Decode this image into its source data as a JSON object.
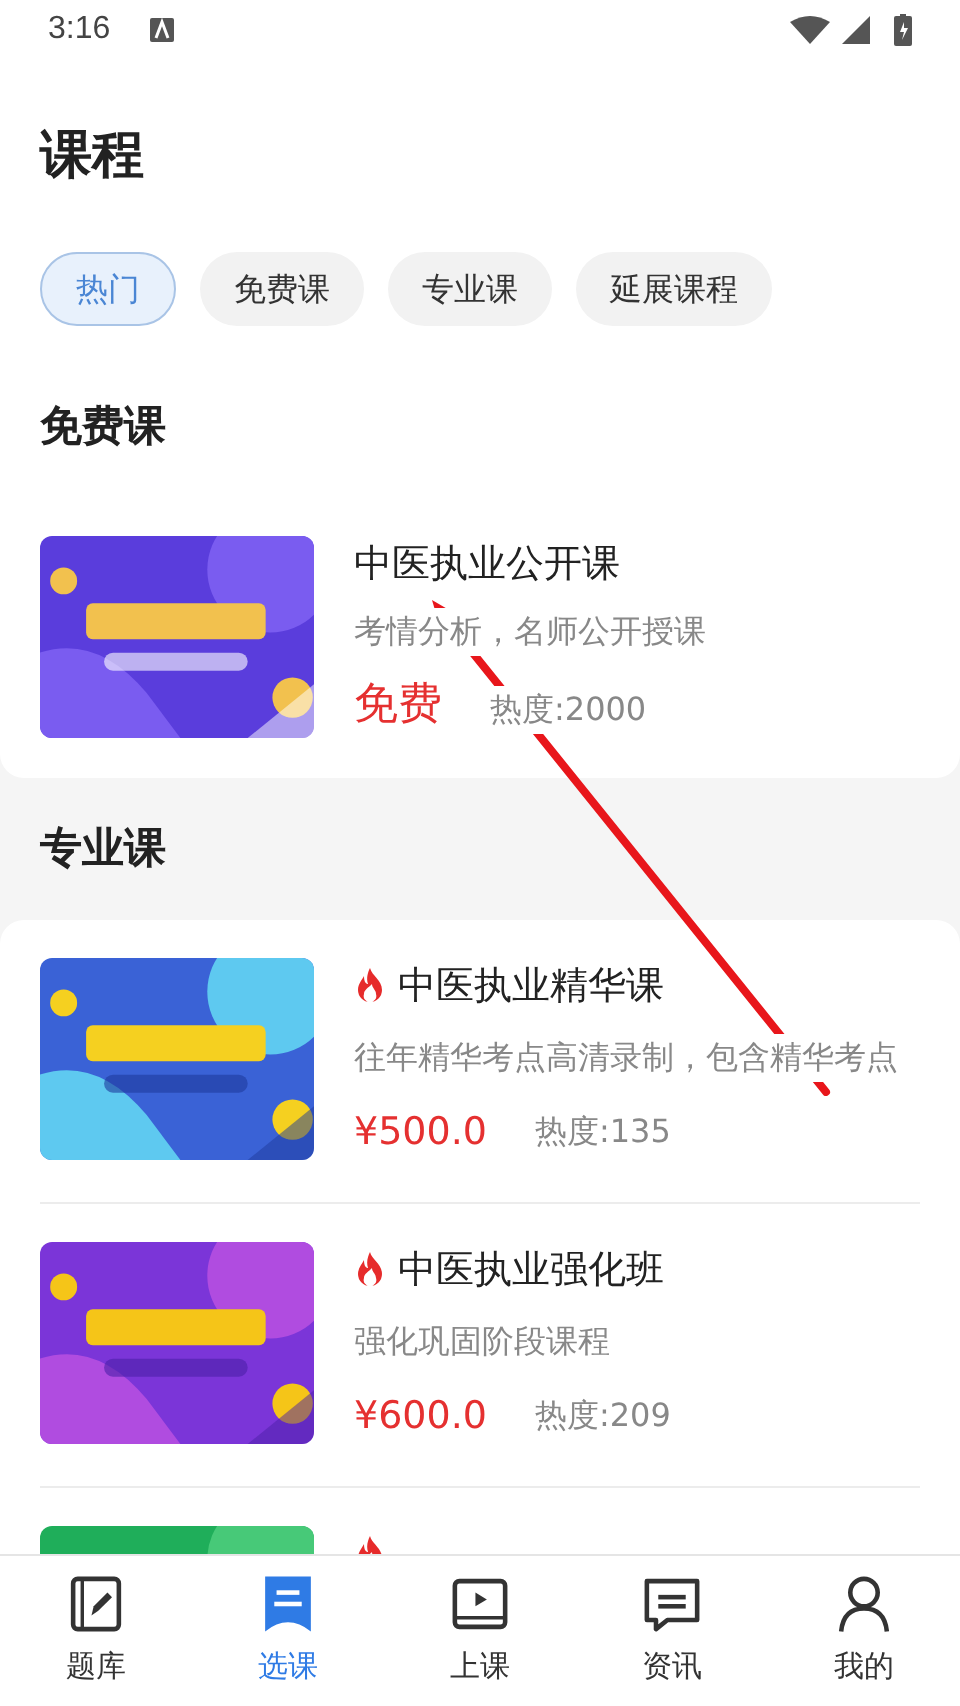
{
  "status_bar": {
    "time": "3:16"
  },
  "page_title": "课程",
  "tabs": [
    {
      "label": "热门",
      "selected": true
    },
    {
      "label": "免费课",
      "selected": false
    },
    {
      "label": "专业课",
      "selected": false
    },
    {
      "label": "延展课程",
      "selected": false
    }
  ],
  "sections": [
    {
      "title": "免费课",
      "courses": [
        {
          "title": "中医执业公开课",
          "hot": false,
          "description": "考情分析，名师公开授课",
          "price": "免费",
          "kind": "free",
          "popularity": "热度:2000"
        }
      ]
    },
    {
      "title": "专业课",
      "courses": [
        {
          "title": "中医执业精华课",
          "hot": true,
          "description": "往年精华考点高清录制，包含精华考点",
          "price": "¥500.0",
          "kind": "paid",
          "popularity": "热度:135"
        },
        {
          "title": "中医执业强化班",
          "hot": true,
          "description": "强化巩固阶段课程",
          "price": "¥600.0",
          "kind": "paid",
          "popularity": "热度:209"
        },
        {
          "hot": true
        }
      ]
    }
  ],
  "bottom_nav": [
    {
      "label": "题库",
      "selected": false
    },
    {
      "label": "选课",
      "selected": true
    },
    {
      "label": "上课",
      "selected": false
    },
    {
      "label": "资讯",
      "selected": false
    },
    {
      "label": "我的",
      "selected": false
    }
  ]
}
